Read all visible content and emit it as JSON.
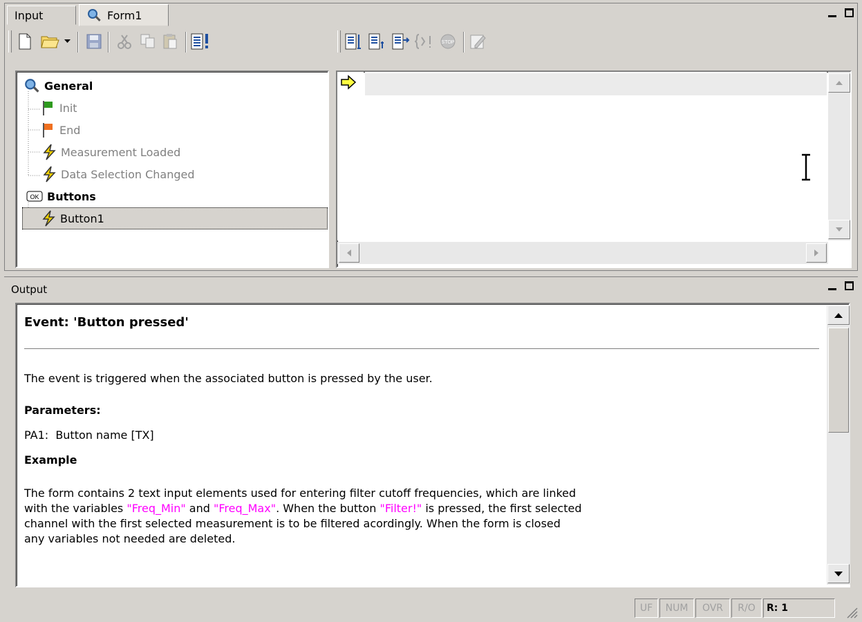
{
  "top_tabs": [
    {
      "label": "Input",
      "active": false
    },
    {
      "label": "Form1",
      "active": true
    }
  ],
  "toolbar_left_icons": [
    "new-document-icon",
    "open-folder-icon",
    "dropdown-arrow-icon",
    "save-icon",
    "cut-icon",
    "copy-icon",
    "paste-icon",
    "run-script-icon"
  ],
  "toolbar_right_icons": [
    "step-into-icon",
    "step-over-icon",
    "step-out-icon",
    "run-to-cursor-icon",
    "stop-icon",
    "edit-form-icon"
  ],
  "tree": {
    "general_label": "General",
    "init_label": "Init",
    "end_label": "End",
    "measurement_loaded_label": "Measurement Loaded",
    "data_selection_changed_label": "Data Selection Changed",
    "buttons_label": "Buttons",
    "button1_label": "Button1"
  },
  "output": {
    "title": "Output",
    "heading": "Event: 'Button pressed'",
    "description": "The event is triggered when the associated button is pressed by the user.",
    "parameters_heading": "Parameters:",
    "param_line": "PA1:  Button name [TX]",
    "example_heading": "Example",
    "example_p1_a": "The form contains 2 text input elements used for entering filter cutoff frequencies, which are linked",
    "example_p2_a": "with the variables ",
    "var_freq_min": "\"Freq_Min\"",
    "and_word": " and ",
    "var_freq_max": "\"Freq_Max\"",
    "example_p2_b": ". When the button ",
    "var_filter": "\"Filter!\"",
    "example_p2_c": " is pressed, the first selected",
    "example_p3": "channel with the first selected measurement is to be filtered acordingly. When the form is closed",
    "example_p4": "any variables not needed are deleted."
  },
  "statusbar": {
    "uf": "UF",
    "num": "NUM",
    "ovr": "OVR",
    "ro": "R/O",
    "row": "R: 1"
  },
  "colors": {
    "face": "#d6d3ce",
    "magenta": "#ff00ff",
    "flag_green": "#2e9a1e",
    "flag_orange": "#f07020",
    "bolt_yellow": "#f0d000"
  }
}
